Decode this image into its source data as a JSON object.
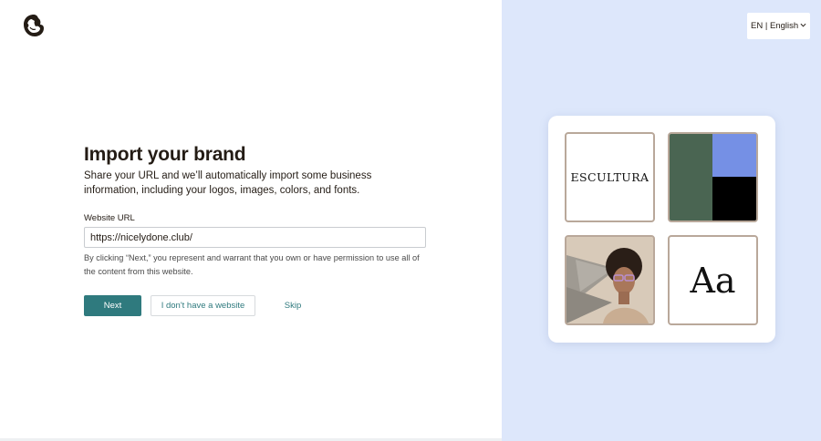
{
  "header": {
    "logo_icon": "mailchimp-freddie-logo-icon",
    "language_label": "EN | English",
    "language_chevron_icon": "chevron-down-icon"
  },
  "form": {
    "title": "Import your brand",
    "description": "Share your URL and we’ll automatically import some business information, including your logos, images, colors, and fonts.",
    "url_label": "Website URL",
    "url_value": "https://nicelydone.club/",
    "disclaimer": "By clicking “Next,” you represent and warrant that you own or have permission to use all of the content from this website.",
    "next_label": "Next",
    "no_website_label": "I don't have a website",
    "skip_label": "Skip"
  },
  "preview": {
    "logo_text": "ESCULTURA",
    "font_sample": "Aa",
    "colors": [
      "#4a6552",
      "#7590e5",
      "#000000"
    ],
    "accent": "#2f7a7e",
    "background": "#dde7fb"
  }
}
